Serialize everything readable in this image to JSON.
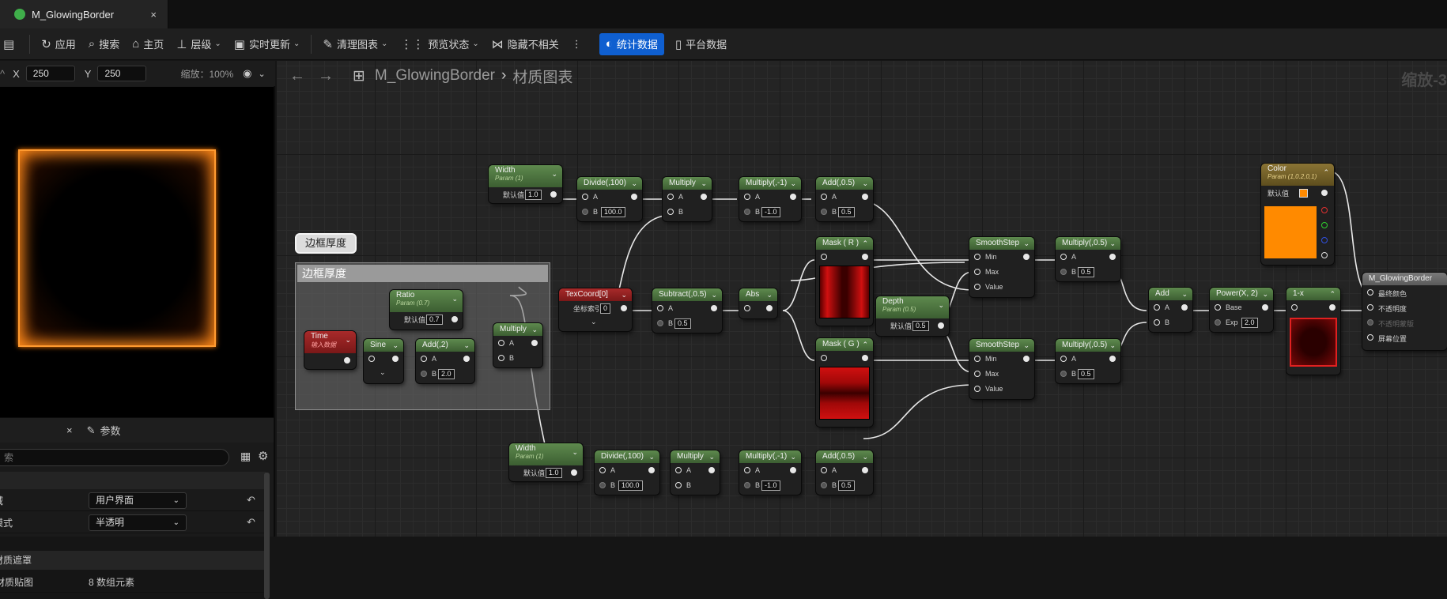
{
  "tab": {
    "title": "M_GlowingBorder",
    "close": "×"
  },
  "toolbar": {
    "apply": "应用",
    "search": "搜索",
    "home": "主页",
    "hierarchy": "层级",
    "live_update": "实时更新",
    "clean_graph": "清理图表",
    "preview_state": "预览状态",
    "hide_unrelated": "隐藏不相关",
    "stats": "统计数据",
    "platform_stats": "平台数据"
  },
  "viewport": {
    "x_label": "X",
    "x_value": "250",
    "y_label": "Y",
    "y_value": "250",
    "zoom": "缩放：100%"
  },
  "details": {
    "tab_label": "参数",
    "search_placeholder": "索",
    "rows": [
      {
        "label": "域",
        "value": "用户界面"
      },
      {
        "label": "模式",
        "value": "半透明"
      }
    ],
    "section": "材质遮罩",
    "last_label": "材质贴图",
    "last_value": "8 数组元素"
  },
  "graph": {
    "breadcrumb_root": "M_GlowingBorder",
    "breadcrumb_child": "材质图表",
    "zoom_label": "缩放-3",
    "comment_bubble": "边框厚度",
    "comment_title": "边框厚度",
    "default_label": "默认值",
    "coord_label": "坐标索引",
    "nodes": {
      "width1": {
        "title": "Width",
        "sub": "Param (1)",
        "value": "1.0"
      },
      "divide1": {
        "title": "Divide(,100)",
        "a": "A",
        "b": "B",
        "b_val": "100.0"
      },
      "multiply1": {
        "title": "Multiply",
        "a": "A",
        "b": "B"
      },
      "mulneg1": {
        "title": "Multiply(,-1)",
        "a": "A",
        "b": "B",
        "b_val": "-1.0"
      },
      "add1": {
        "title": "Add(,0.5)",
        "a": "A",
        "b": "B",
        "b_val": "0.5"
      },
      "mask_r": {
        "title": "Mask ( R )"
      },
      "mask_g": {
        "title": "Mask ( G )"
      },
      "ss1": {
        "title": "SmoothStep",
        "min": "Min",
        "max": "Max",
        "value": "Value"
      },
      "ss2": {
        "title": "SmoothStep",
        "min": "Min",
        "max": "Max",
        "value": "Value"
      },
      "mul05a": {
        "title": "Multiply(,0.5)",
        "a": "A",
        "b": "B",
        "b_val": "0.5"
      },
      "mul05b": {
        "title": "Multiply(,0.5)",
        "a": "A",
        "b": "B",
        "b_val": "0.5"
      },
      "color": {
        "title": "Color",
        "sub": "Param (1,0.2,0,1)"
      },
      "addf": {
        "title": "Add",
        "a": "A",
        "b": "B"
      },
      "power": {
        "title": "Power(X, 2)",
        "base": "Base",
        "exp": "Exp",
        "exp_val": "2.0"
      },
      "oneminus": {
        "title": "1-x"
      },
      "output": {
        "title": "M_GlowingBorder",
        "p1": "最终颜色",
        "p2": "不透明度",
        "p3": "不透明蒙版",
        "p4": "屏幕位置"
      },
      "texcoord": {
        "title": "TexCoord[0]",
        "value": "0"
      },
      "subtract": {
        "title": "Subtract(,0.5)",
        "a": "A",
        "b": "B",
        "b_val": "0.5"
      },
      "abs": {
        "title": "Abs"
      },
      "depth": {
        "title": "Depth",
        "sub": "Param (0.5)",
        "value": "0.5"
      },
      "ratio": {
        "title": "Ratio",
        "sub": "Param (0.7)",
        "value": "0.7"
      },
      "time": {
        "title": "Time",
        "sub": "输入数据"
      },
      "sine": {
        "title": "Sine"
      },
      "add2": {
        "title": "Add(,2)",
        "a": "A",
        "b": "B",
        "b_val": "2.0"
      },
      "multiply_c": {
        "title": "Multiply",
        "a": "A",
        "b": "B"
      },
      "width2": {
        "title": "Width",
        "sub": "Param (1)",
        "value": "1.0"
      },
      "divide2": {
        "title": "Divide(,100)",
        "a": "A",
        "b": "B",
        "b_val": "100.0"
      },
      "multiply2": {
        "title": "Multiply",
        "a": "A",
        "b": "B"
      },
      "mulneg2": {
        "title": "Multiply(,-1)",
        "a": "A",
        "b": "B",
        "b_val": "-1.0"
      },
      "add3": {
        "title": "Add(,0.5)",
        "a": "A",
        "b": "B",
        "b_val": "0.5"
      }
    }
  },
  "colors": {
    "accent": "#0f5fd0",
    "glow": "#ff8a1a",
    "color_param": "#ff8a00"
  }
}
